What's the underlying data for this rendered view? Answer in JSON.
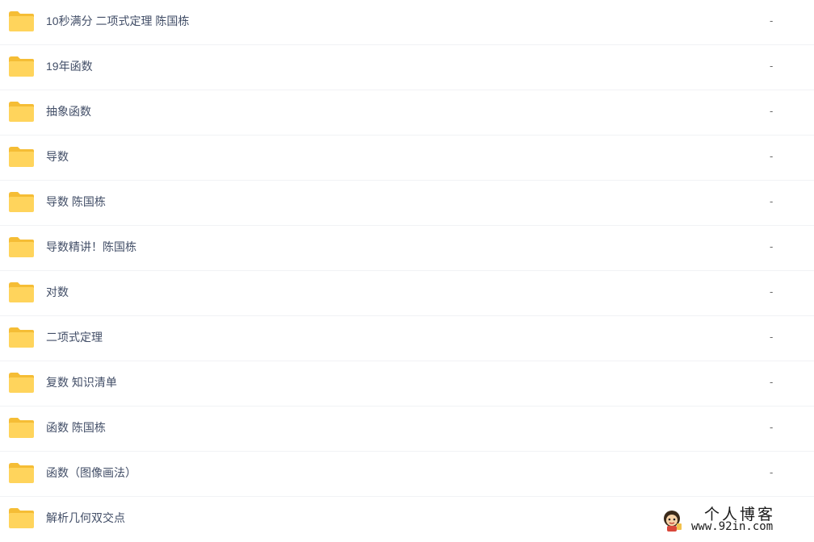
{
  "file_list": {
    "items": [
      {
        "name": "10秒满分 二项式定理 陈国栋",
        "size": "-",
        "icon": "folder-icon"
      },
      {
        "name": "19年函数",
        "size": "-",
        "icon": "folder-icon"
      },
      {
        "name": "抽象函数",
        "size": "-",
        "icon": "folder-icon"
      },
      {
        "name": "导数",
        "size": "-",
        "icon": "folder-icon"
      },
      {
        "name": "导数 陈国栋",
        "size": "-",
        "icon": "folder-icon"
      },
      {
        "name": "导数精讲！陈国栋",
        "size": "-",
        "icon": "folder-icon"
      },
      {
        "name": "对数",
        "size": "-",
        "icon": "folder-icon"
      },
      {
        "name": "二项式定理",
        "size": "-",
        "icon": "folder-icon"
      },
      {
        "name": "复数 知识清单",
        "size": "-",
        "icon": "folder-icon"
      },
      {
        "name": "函数 陈国栋",
        "size": "-",
        "icon": "folder-icon"
      },
      {
        "name": "函数（图像画法）",
        "size": "-",
        "icon": "folder-icon"
      },
      {
        "name": "解析几何双交点",
        "size": "",
        "icon": "folder-icon"
      }
    ]
  },
  "watermark": {
    "title": "个人博客",
    "url": "www.92in.com"
  },
  "colors": {
    "folder_body": "#ffd45c",
    "folder_tab": "#f5bd35",
    "text": "#424e67",
    "divider": "#f1f2f5"
  }
}
